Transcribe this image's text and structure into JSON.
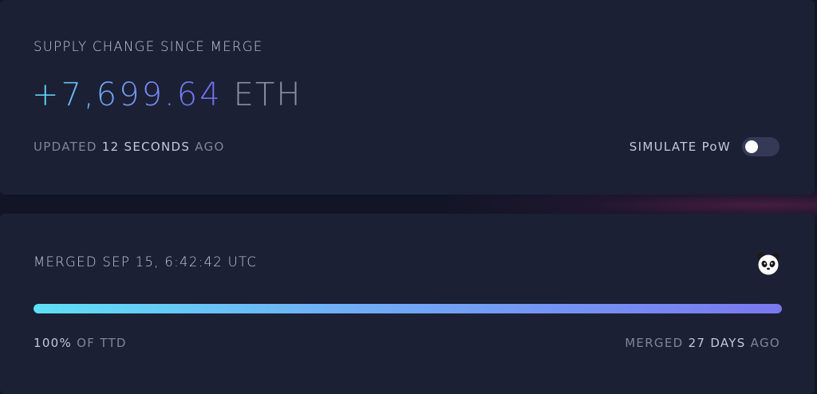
{
  "supply": {
    "title": "SUPPLY CHANGE SINCE MERGE",
    "value": "+7,699.64",
    "unit": "ETH",
    "updated_prefix": "UPDATED ",
    "updated_value": "12 SECONDS",
    "updated_suffix": " AGO",
    "simulate_label": "SIMULATE PoW",
    "simulate_pow_enabled": false
  },
  "merge": {
    "title": "MERGED SEP 15, 6:42:42 UTC",
    "icon": "panda-icon",
    "progress_percent": 100,
    "ttd_value": "100%",
    "ttd_suffix": " OF TTD",
    "merged_prefix": "MERGED ",
    "merged_value": "27 DAYS",
    "merged_suffix": " AGO"
  },
  "colors": {
    "background": "#121526",
    "card": "#1b2035",
    "accent_start": "#5ed6f0",
    "accent_end": "#6f6cf0"
  }
}
